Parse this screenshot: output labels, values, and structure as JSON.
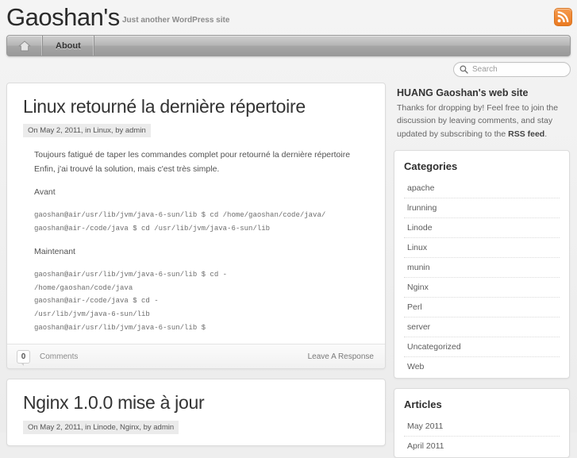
{
  "header": {
    "site_title": "Gaoshan's",
    "tagline": "Just another WordPress site",
    "rss_icon": "rss-icon"
  },
  "nav": {
    "home_icon": "home-icon",
    "items": [
      {
        "label": "About"
      }
    ]
  },
  "search": {
    "icon": "search-icon",
    "placeholder": "Search",
    "value": ""
  },
  "posts": [
    {
      "title": "Linux retourné la dernière répertoire",
      "meta": "On May 2, 2011, in Linux, by admin",
      "paragraphs": [
        "Toujours fatigué de taper les commandes complet pour retourné la dernière répertoire Enfin, j'ai trouvé la solution, mais c'est très simple.",
        "Avant"
      ],
      "code_before": "gaoshan@air/usr/lib/jvm/java-6-sun/lib $ cd /home/gaoshan/code/java/\ngaoshan@air-/code/java $ cd /usr/lib/jvm/java-6-sun/lib",
      "label_after": "Maintenant",
      "code_after": "gaoshan@air/usr/lib/jvm/java-6-sun/lib $ cd -\n/home/gaoshan/code/java\ngaoshan@air-/code/java $ cd -\n/usr/lib/jvm/java-6-sun/lib\ngaoshan@air/usr/lib/jvm/java-6-sun/lib $",
      "comment_count": "0",
      "comments_label": "Comments",
      "response_label": "Leave A Response"
    },
    {
      "title": "Nginx 1.0.0 mise à jour",
      "meta": "On May 2, 2011, in Linode, Nginx, by admin"
    }
  ],
  "sidebar": {
    "intro": {
      "heading": "HUANG Gaoshan's web site",
      "text_before": "Thanks for dropping by! Feel free to join the discussion by leaving comments, and stay updated by subscribing to the ",
      "link": "RSS feed",
      "text_after": "."
    },
    "categories": {
      "heading": "Categories",
      "items": [
        {
          "label": "apache"
        },
        {
          "label": "lrunning"
        },
        {
          "label": "Linode"
        },
        {
          "label": "Linux"
        },
        {
          "label": "munin"
        },
        {
          "label": "Nginx"
        },
        {
          "label": "Perl"
        },
        {
          "label": "server"
        },
        {
          "label": "Uncategorized"
        },
        {
          "label": "Web"
        }
      ]
    },
    "articles": {
      "heading": "Articles",
      "items": [
        {
          "label": "May 2011"
        },
        {
          "label": "April 2011"
        }
      ]
    }
  },
  "colors": {
    "rss_orange": "#ea7a21",
    "page_bg": "#efefef",
    "card_bg": "#ffffff",
    "nav_gray": "#b0b0b0"
  }
}
